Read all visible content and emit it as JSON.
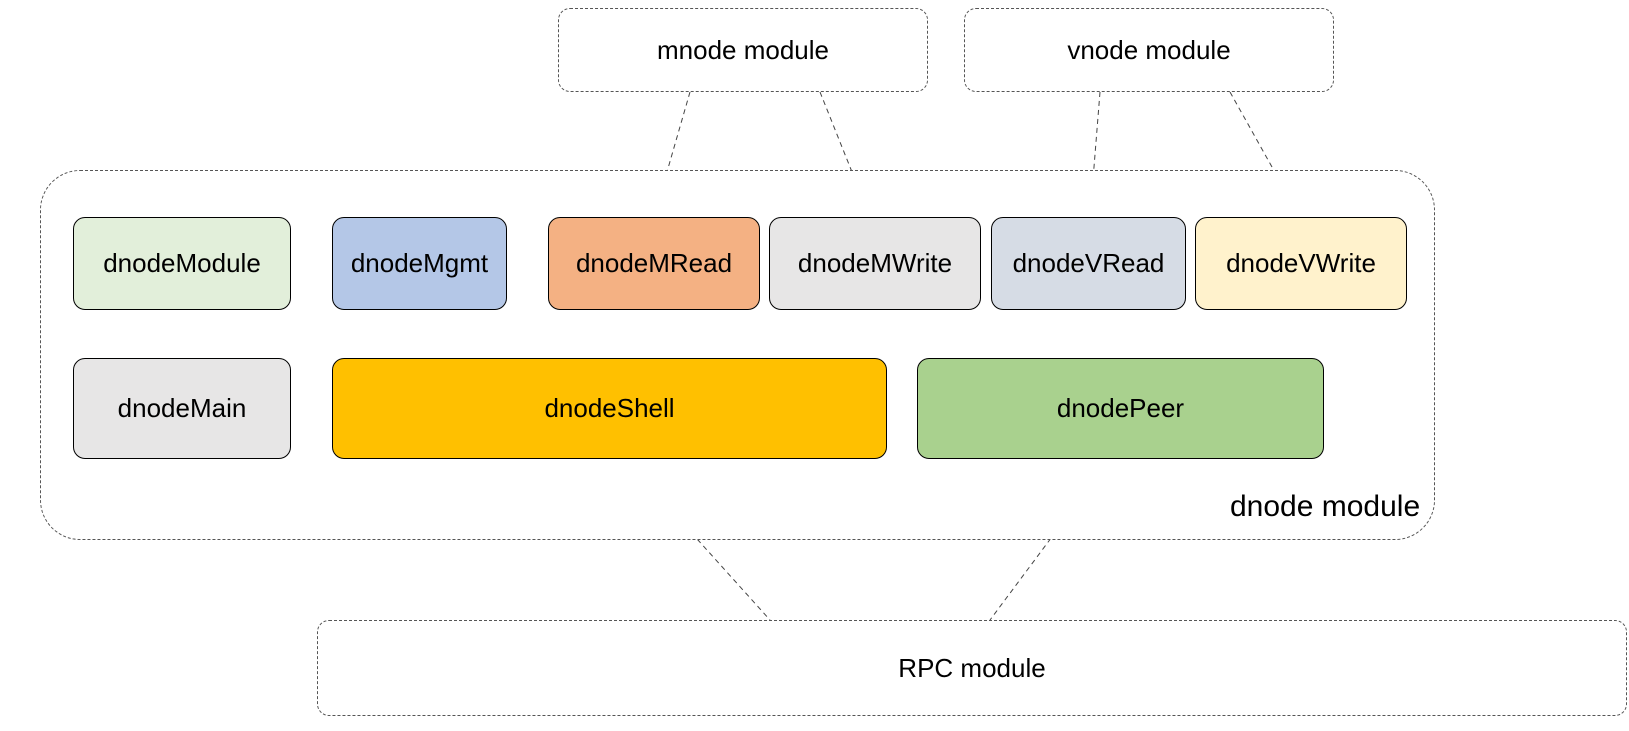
{
  "top_modules": {
    "mnode": "mnode module",
    "vnode": "vnode module"
  },
  "dnode": {
    "label": "dnode module",
    "row1": {
      "dnodeModule": "dnodeModule",
      "dnodeMgmt": "dnodeMgmt",
      "dnodeMRead": "dnodeMRead",
      "dnodeMWrite": "dnodeMWrite",
      "dnodeVRead": "dnodeVRead",
      "dnodeVWrite": "dnodeVWrite"
    },
    "row2": {
      "dnodeMain": "dnodeMain",
      "dnodeShell": "dnodeShell",
      "dnodePeer": "dnodePeer"
    }
  },
  "bottom": {
    "rpc": "RPC module"
  },
  "colors": {
    "dnodeModule": "#E2EFDA",
    "dnodeMgmt": "#B4C7E7",
    "dnodeMRead": "#F4B183",
    "dnodeMWrite": "#E7E6E6",
    "dnodeVRead": "#D6DCE5",
    "dnodeVWrite": "#FFF2CC",
    "dnodeMain": "#E7E6E6",
    "dnodeShell": "#FFC000",
    "dnodePeer": "#A9D18E"
  }
}
